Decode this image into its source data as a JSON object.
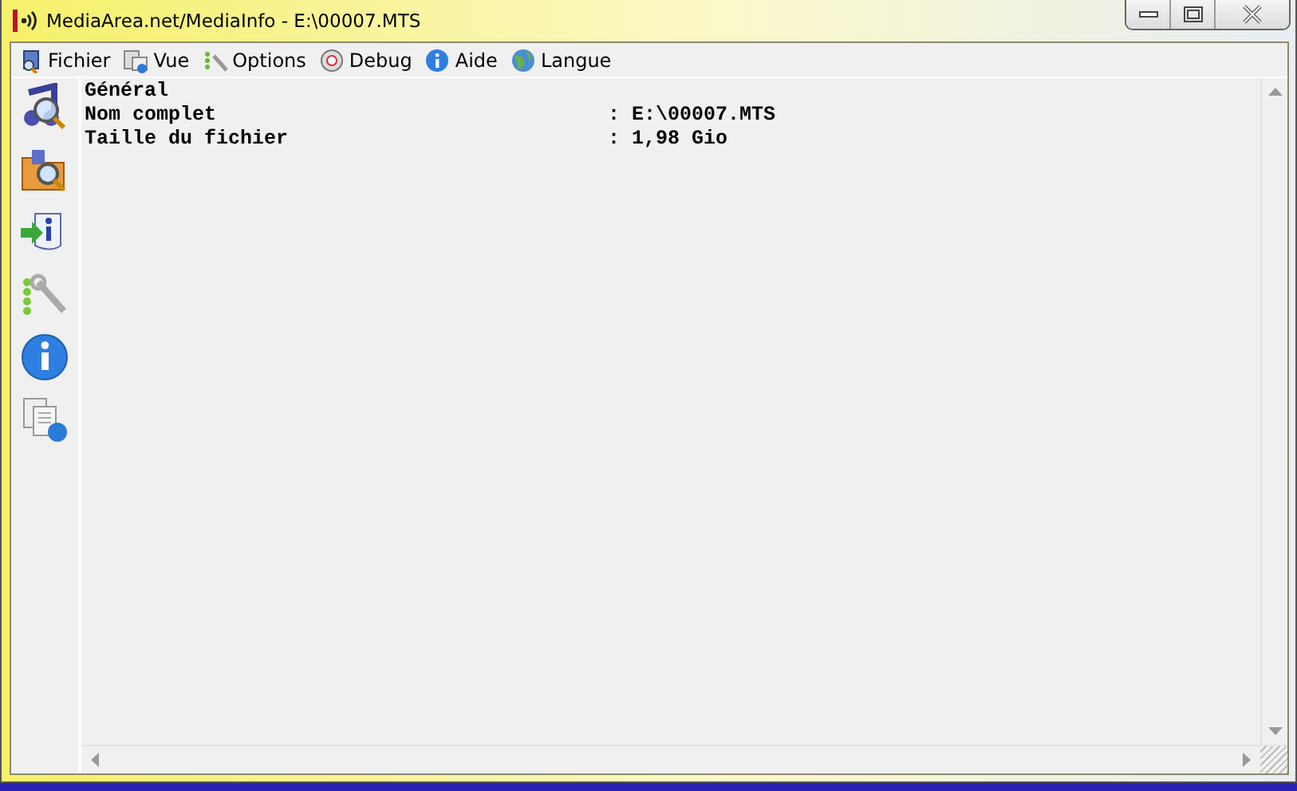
{
  "window": {
    "title": "MediaArea.net/MediaInfo - E:\\00007.MTS"
  },
  "menu": [
    {
      "label": "Fichier"
    },
    {
      "label": "Vue"
    },
    {
      "label": "Options"
    },
    {
      "label": "Debug"
    },
    {
      "label": "Aide"
    },
    {
      "label": "Langue"
    }
  ],
  "report": [
    {
      "title": "Général",
      "fields": [
        {
          "label": "Nom complet",
          "value": ": E:\\00007.MTS"
        },
        {
          "label": "Taille du fichier",
          "value": ": 1,98 Gio"
        }
      ]
    }
  ]
}
